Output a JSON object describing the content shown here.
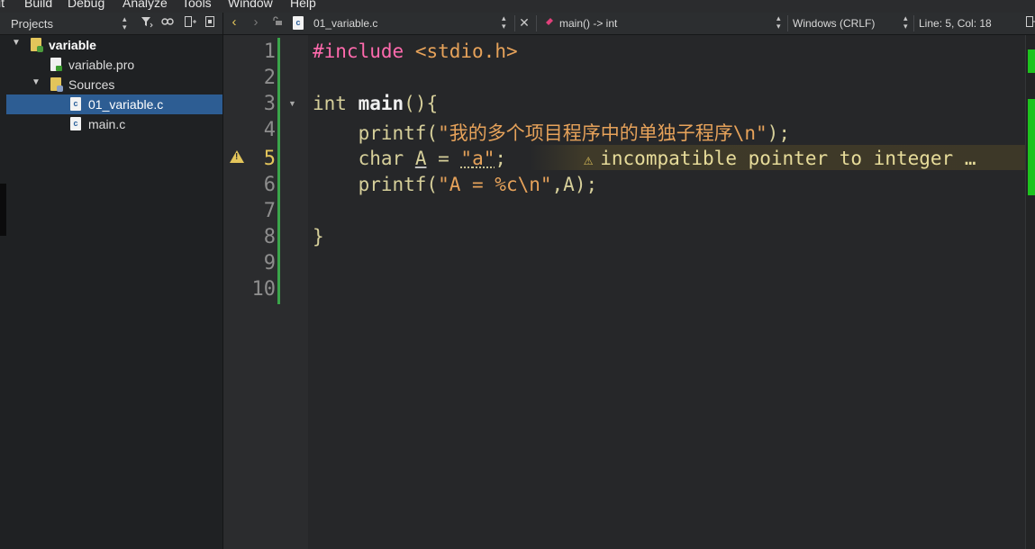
{
  "menubar": {
    "items": [
      "it",
      "Build",
      "Debug",
      "Analyze",
      "Tools",
      "Window",
      "Help"
    ]
  },
  "left_panel": {
    "title": "Projects",
    "tree": [
      {
        "label": "variable",
        "icon": "pro-folder-icon",
        "expanded": true
      },
      {
        "label": "variable.pro",
        "icon": "pro-file-icon"
      },
      {
        "label": "Sources",
        "icon": "folder-icon",
        "expanded": true
      },
      {
        "label": "01_variable.c",
        "icon": "c-file-icon",
        "selected": true
      },
      {
        "label": "main.c",
        "icon": "c-file-icon"
      }
    ]
  },
  "editor_toolbar": {
    "file_name": "01_variable.c",
    "file_icon_text": "c",
    "symbol": "main() -> int",
    "line_ending": "Windows (CRLF)",
    "position": "Line: 5, Col: 18"
  },
  "editor": {
    "line_numbers": [
      "1",
      "2",
      "3",
      "4",
      "5",
      "6",
      "7",
      "8",
      "9",
      "10"
    ],
    "current_line": "5",
    "code": {
      "l1_pp": "#include",
      "l1_sp": " ",
      "l1_inc": "<stdio.h>",
      "l3_type": "int",
      "l3_sp": " ",
      "l3_fn": "main",
      "l3_rest": "(){",
      "l4_indent": "    ",
      "l4_call": "printf(",
      "l4_str": "\"我的多个项目程序中的单独子程序\\n\"",
      "l4_end": ");",
      "l5_indent": "    ",
      "l5_type": "char",
      "l5_sp": " ",
      "l5_var": "A",
      "l5_eq": " = ",
      "l5_q1": "\"",
      "l5_ch": "a",
      "l5_q2": "\"",
      "l5_end": ";",
      "l6_indent": "    ",
      "l6_call": "printf(",
      "l6_str": "\"A = %c\\n\"",
      "l6_end": ",A);",
      "l8": "}"
    },
    "warning_text": "incompatible pointer to integer …",
    "warning_glyph": "⚠",
    "gutter_warning_glyph": "!"
  },
  "colors": {
    "selection": "#2d5d93",
    "warning": "#e3c55b",
    "preprocessor": "#ff6aad",
    "string": "#e6a25a",
    "change_bar": "#3aa54a"
  }
}
